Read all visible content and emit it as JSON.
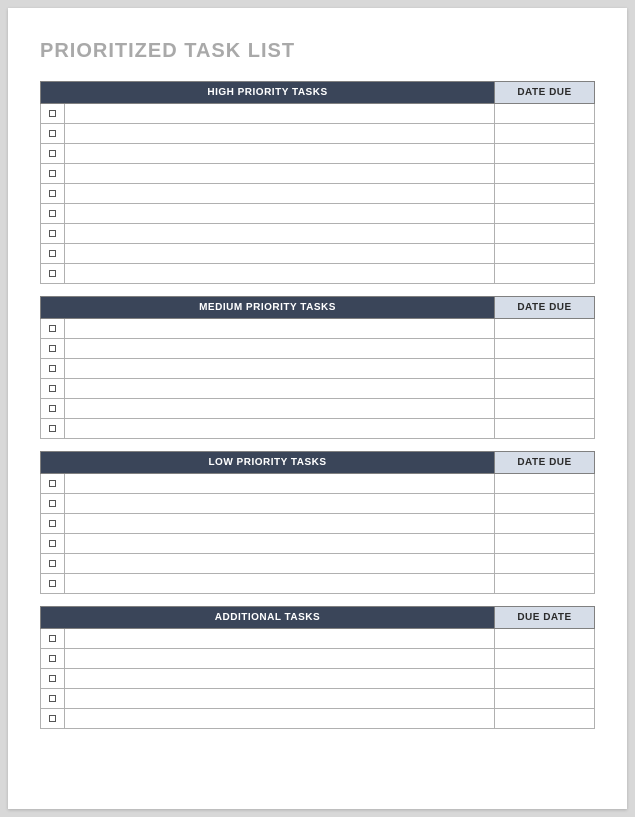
{
  "title": "PRIORITIZED TASK LIST",
  "sections": [
    {
      "task_header": "HIGH PRIORITY TASKS",
      "date_header": "DATE DUE",
      "rows": [
        {
          "checked": false,
          "task": "",
          "due": ""
        },
        {
          "checked": false,
          "task": "",
          "due": ""
        },
        {
          "checked": false,
          "task": "",
          "due": ""
        },
        {
          "checked": false,
          "task": "",
          "due": ""
        },
        {
          "checked": false,
          "task": "",
          "due": ""
        },
        {
          "checked": false,
          "task": "",
          "due": ""
        },
        {
          "checked": false,
          "task": "",
          "due": ""
        },
        {
          "checked": false,
          "task": "",
          "due": ""
        },
        {
          "checked": false,
          "task": "",
          "due": ""
        }
      ]
    },
    {
      "task_header": "MEDIUM PRIORITY TASKS",
      "date_header": "DATE DUE",
      "rows": [
        {
          "checked": false,
          "task": "",
          "due": ""
        },
        {
          "checked": false,
          "task": "",
          "due": ""
        },
        {
          "checked": false,
          "task": "",
          "due": ""
        },
        {
          "checked": false,
          "task": "",
          "due": ""
        },
        {
          "checked": false,
          "task": "",
          "due": ""
        },
        {
          "checked": false,
          "task": "",
          "due": ""
        }
      ]
    },
    {
      "task_header": "LOW PRIORITY TASKS",
      "date_header": "DATE DUE",
      "rows": [
        {
          "checked": false,
          "task": "",
          "due": ""
        },
        {
          "checked": false,
          "task": "",
          "due": ""
        },
        {
          "checked": false,
          "task": "",
          "due": ""
        },
        {
          "checked": false,
          "task": "",
          "due": ""
        },
        {
          "checked": false,
          "task": "",
          "due": ""
        },
        {
          "checked": false,
          "task": "",
          "due": ""
        }
      ]
    },
    {
      "task_header": "ADDITIONAL TASKS",
      "date_header": "DUE DATE",
      "rows": [
        {
          "checked": false,
          "task": "",
          "due": ""
        },
        {
          "checked": false,
          "task": "",
          "due": ""
        },
        {
          "checked": false,
          "task": "",
          "due": ""
        },
        {
          "checked": false,
          "task": "",
          "due": ""
        },
        {
          "checked": false,
          "task": "",
          "due": ""
        }
      ]
    }
  ]
}
